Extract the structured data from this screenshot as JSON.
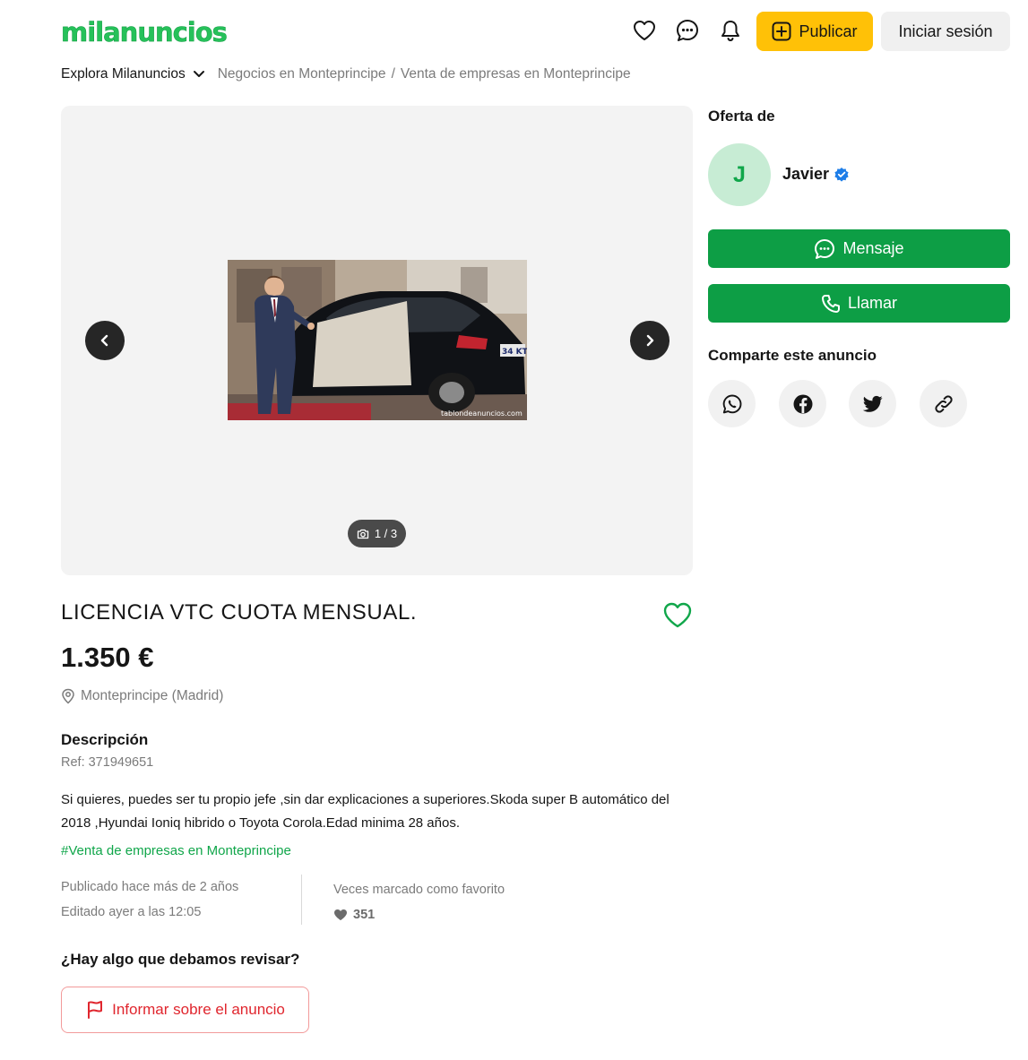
{
  "header": {
    "logo_text": "milanuncios",
    "icons": [
      "heart-icon",
      "chat-icon",
      "bell-icon"
    ],
    "publish_label": "Publicar",
    "login_label": "Iniciar sesión"
  },
  "breadcrumb": {
    "explore_label": "Explora Milanuncios",
    "items": [
      "Negocios en Monteprincipe",
      "Venta de empresas en Monteprincipe"
    ],
    "separator": "/"
  },
  "gallery": {
    "counter": "1 / 3",
    "watermark": "tablondeanuncios.com",
    "plate_text": "34 KT"
  },
  "ad": {
    "title": "LICENCIA VTC CUOTA MENSUAL.",
    "price": "1.350 €",
    "location": "Monteprincipe (Madrid)",
    "description_heading": "Descripción",
    "ref": "Ref: 371949651",
    "description": "Si quieres, puedes ser tu propio jefe ,sin dar explicaciones a superiores.Skoda super B automático del 2018 ,Hyundai Ioniq hibrido o Toyota Corola.Edad minima 28 años.",
    "tag": "#Venta de empresas en Monteprincipe",
    "published": "Publicado hace más de 2 años",
    "edited": "Editado ayer a las 12:05",
    "favorite_label": "Veces marcado como favorito",
    "favorite_count": "351",
    "review_heading": "¿Hay algo que debamos revisar?",
    "report_label": "Informar sobre el anuncio"
  },
  "sidebar": {
    "offer_heading": "Oferta de",
    "avatar_initial": "J",
    "seller_name": "Javier",
    "message_label": "Mensaje",
    "call_label": "Llamar",
    "share_heading": "Comparte este anuncio",
    "share_icons": [
      "whatsapp-icon",
      "facebook-icon",
      "twitter-icon",
      "link-icon"
    ]
  },
  "colors": {
    "brand_green": "#0d9e45",
    "publish_yellow": "#ffc107",
    "report_red": "#e0262e"
  }
}
